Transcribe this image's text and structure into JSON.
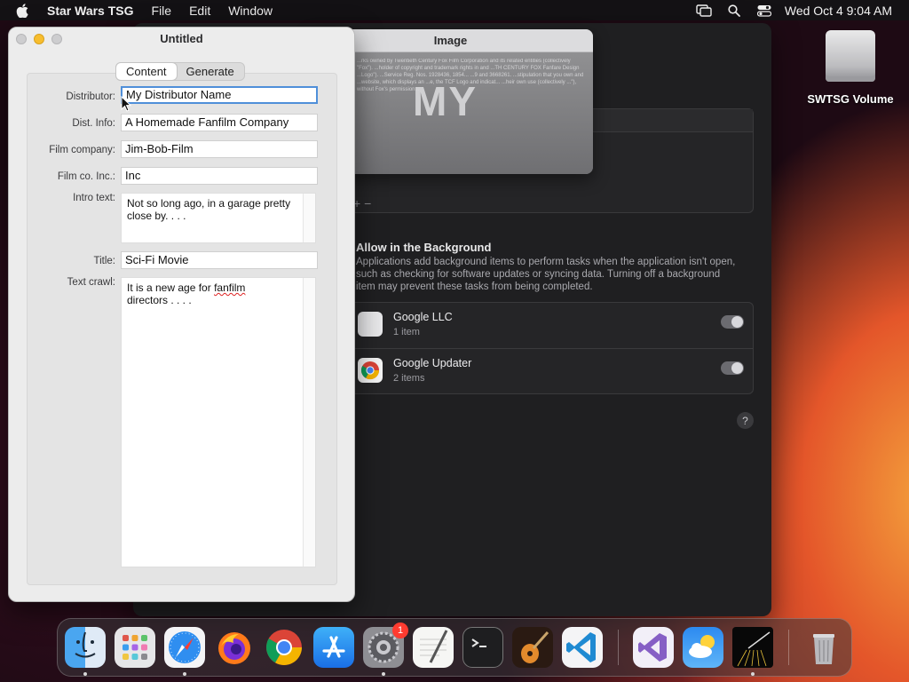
{
  "menubar": {
    "app_name": "Star Wars TSG",
    "menus": [
      "File",
      "Edit",
      "Window"
    ],
    "clock": "Wed Oct 4  9:04 AM"
  },
  "desktop": {
    "drive_label": "SWTSG Volume"
  },
  "main_window": {
    "title": "Untitled",
    "tabs": [
      "Content",
      "Generate"
    ],
    "active_tab": "Content",
    "fields": {
      "distributor_label": "Distributor:",
      "distributor_value": "My Distributor Name",
      "dist_info_label": "Dist. Info:",
      "dist_info_value": "A Homemade Fanfilm Company",
      "film_company_label": "Film company:",
      "film_company_value": "Jim-Bob-Film",
      "film_co_inc_label": "Film co. Inc.:",
      "film_co_inc_value": "Inc",
      "intro_text_label": "Intro text:",
      "intro_text_value": "Not so long ago, in a garage pretty close by. . . .",
      "title_label": "Title:",
      "title_value": "Sci-Fi Movie",
      "text_crawl_label": "Text crawl:",
      "text_crawl_line1_prefix": "It is a new age for ",
      "text_crawl_misspelled": "fanfilm",
      "text_crawl_line2": "directors . . . ."
    }
  },
  "image_window": {
    "title": "Image",
    "preview_large_text": "MY",
    "preview_legal_text": "...rks owned by Twentieth Century Fox Film Corporation and its related entities (collectively \"Fox\"). ...holder of copyright and trademark rights in and ...TH CENTURY FOX Fanfare Design ...Logo\"). ...Service Reg. Nos. 1928436, 1854... ...9 and 3668261. ...stipulation that you own and ...website, which displays an ...e, the TCF Logo and indicat... ...heir own use (collectively ...\"), without Fox's permission..."
  },
  "settings_window": {
    "plus_minus": "+   −",
    "allow_title": "Allow in the Background",
    "allow_desc": "Applications add background items to perform tasks when the application isn't open, such as checking for software updates or syncing data. Turning off a background item may prevent these tasks from being completed.",
    "items": [
      {
        "name": "Google LLC",
        "sub": "1 item",
        "enabled": true
      },
      {
        "name": "Google Updater",
        "sub": "2 items",
        "enabled": true
      }
    ],
    "help": "?"
  },
  "dock": {
    "apps": [
      "Finder",
      "Launchpad",
      "Safari",
      "Firefox",
      "Chrome",
      "App Store",
      "System Settings",
      "TextEdit",
      "Terminal",
      "GarageBand",
      "Visual Studio Code",
      "Visual Studio",
      "Weather",
      "Star Wars TSG",
      "Trash"
    ],
    "settings_badge": "1"
  }
}
